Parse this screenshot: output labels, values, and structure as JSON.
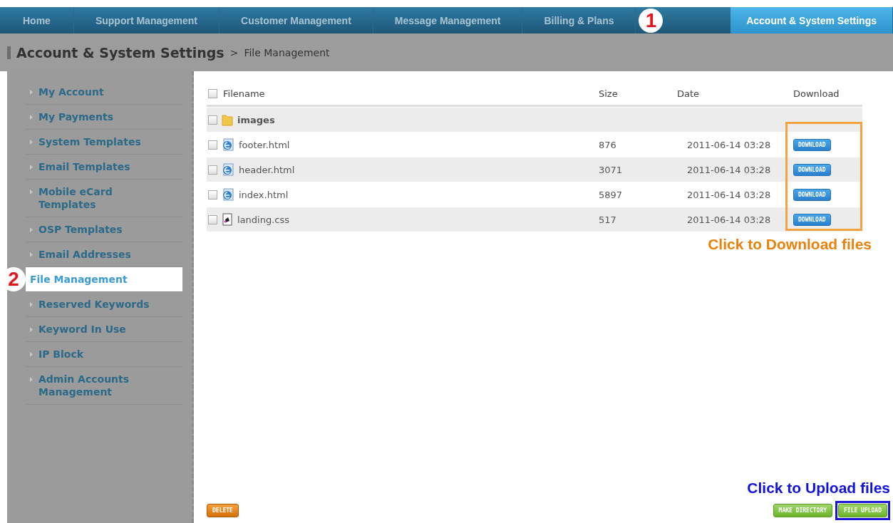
{
  "nav": {
    "tabs": [
      {
        "label": "Home",
        "selected": false
      },
      {
        "label": "Support Management",
        "selected": false
      },
      {
        "label": "Customer Management",
        "selected": false
      },
      {
        "label": "Message Management",
        "selected": false
      },
      {
        "label": "Billing & Plans",
        "selected": false
      },
      {
        "label": "Account & System Settings",
        "selected": true,
        "callout": "1"
      }
    ]
  },
  "breadcrumb": {
    "section": "Account & System Settings",
    "separator": ">",
    "page": "File Management"
  },
  "sidebar": {
    "items": [
      {
        "label": "My Account",
        "selected": false
      },
      {
        "label": "My Payments",
        "selected": false
      },
      {
        "label": "System Templates",
        "selected": false
      },
      {
        "label": "Email Templates",
        "selected": false
      },
      {
        "label": "Mobile eCard Templates",
        "selected": false
      },
      {
        "label": "OSP Templates",
        "selected": false
      },
      {
        "label": "Email Addresses",
        "selected": false
      },
      {
        "label": "File Management",
        "selected": true,
        "callout": "2"
      },
      {
        "label": "Reserved Keywords",
        "selected": false
      },
      {
        "label": "Keyword In Use",
        "selected": false
      },
      {
        "label": "IP Block",
        "selected": false
      },
      {
        "label": "Admin Accounts Management",
        "selected": false
      }
    ]
  },
  "table": {
    "select_all_checked": false,
    "columns": [
      "Filename",
      "Size",
      "Date",
      "Download"
    ],
    "rows": [
      {
        "kind": "folder",
        "name": "images",
        "checked": false
      },
      {
        "kind": "html",
        "name": "footer.html",
        "size": "876",
        "date": "2011-06-14 03:28",
        "download": "DOWNLOAD",
        "checked": false
      },
      {
        "kind": "html",
        "name": "header.html",
        "size": "3071",
        "date": "2011-06-14 03:28",
        "download": "DOWNLOAD",
        "checked": false
      },
      {
        "kind": "html",
        "name": "index.html",
        "size": "5897",
        "date": "2011-06-14 03:28",
        "download": "DOWNLOAD",
        "checked": false
      },
      {
        "kind": "css",
        "name": "landing.css",
        "size": "517",
        "date": "2011-06-14 03:28",
        "download": "DOWNLOAD",
        "checked": false
      }
    ]
  },
  "download_note": "Click to Download files",
  "upload_note": "Click to Upload files",
  "buttons": {
    "delete": "DELETE",
    "make_directory": "MAKE DIRECTORY",
    "file_upload": "FILE UPLOAD"
  }
}
